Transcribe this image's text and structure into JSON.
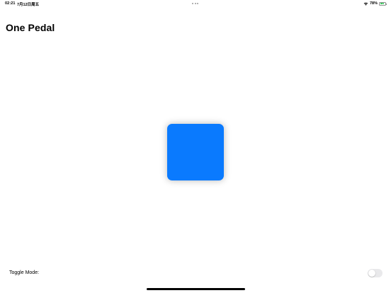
{
  "status_bar": {
    "time": "02:21",
    "date": "7月12日周五",
    "battery_percent": "78%",
    "battery_level": 0.78,
    "battery_color": "#34c759",
    "wifi_icon": "wifi-icon",
    "battery_icon": "battery-charging-icon"
  },
  "header": {
    "title": "One Pedal"
  },
  "main": {
    "pedal_color": "#0a7afe"
  },
  "footer": {
    "toggle_label": "Toggle Mode:",
    "toggle_on": false
  }
}
